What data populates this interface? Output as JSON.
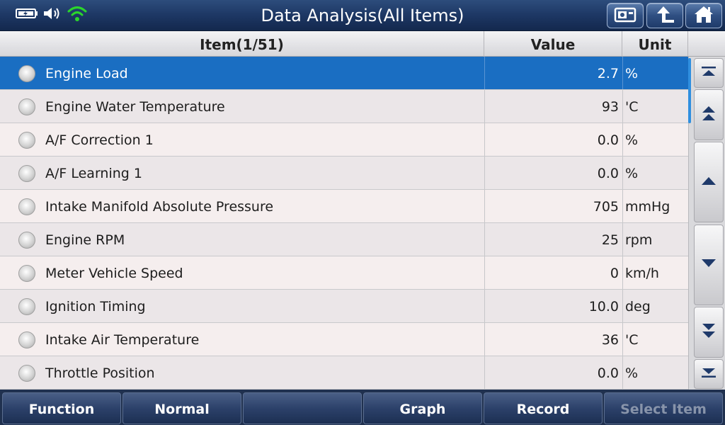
{
  "header": {
    "title": "Data Analysis(All Items)",
    "buttons": [
      "screenshot-icon",
      "back-icon",
      "home-icon"
    ]
  },
  "table": {
    "columns": {
      "item": "Item(1/51)",
      "value": "Value",
      "unit": "Unit"
    },
    "rows": [
      {
        "name": "Engine Load",
        "value": "2.7",
        "unit": "%",
        "selected": true
      },
      {
        "name": "Engine Water Temperature",
        "value": "93",
        "unit": "'C"
      },
      {
        "name": "A/F Correction 1",
        "value": "0.0",
        "unit": "%"
      },
      {
        "name": "A/F Learning 1",
        "value": "0.0",
        "unit": "%"
      },
      {
        "name": "Intake Manifold Absolute Pressure",
        "value": "705",
        "unit": "mmHg"
      },
      {
        "name": "Engine RPM",
        "value": "25",
        "unit": "rpm"
      },
      {
        "name": "Meter Vehicle Speed",
        "value": "0",
        "unit": "km/h"
      },
      {
        "name": "Ignition Timing",
        "value": "10.0",
        "unit": "deg"
      },
      {
        "name": "Intake Air Temperature",
        "value": "36",
        "unit": "'C"
      },
      {
        "name": "Throttle Position",
        "value": "0.0",
        "unit": "%"
      }
    ]
  },
  "footer": {
    "function": "Function",
    "normal": "Normal",
    "empty": "",
    "graph": "Graph",
    "record": "Record",
    "select_item": "Select Item"
  },
  "colors": {
    "header": "#1d3764",
    "selected_row": "#1a6ec2",
    "footer": "#20314f",
    "wifi": "#2bd62b"
  }
}
